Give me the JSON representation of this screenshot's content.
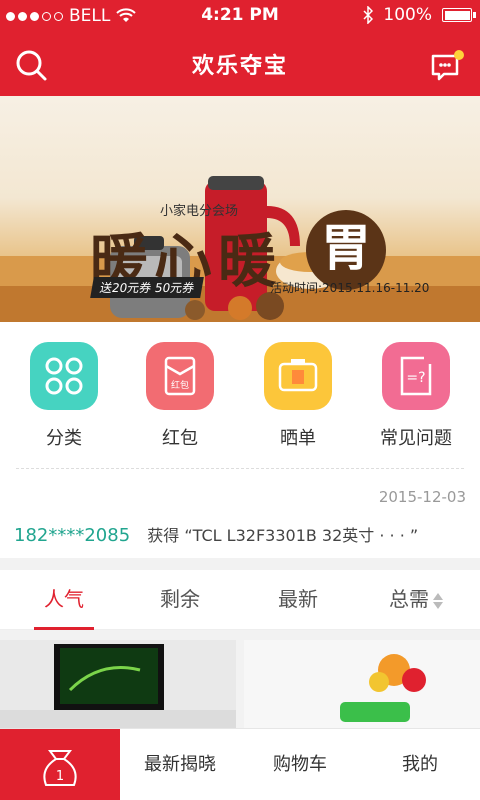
{
  "status_bar": {
    "carrier": "BELL",
    "time": "4:21 PM",
    "battery": "100%"
  },
  "nav": {
    "title": "欢乐夺宝"
  },
  "banner": {
    "subtitle": "小家电分会场",
    "headline": "暖心暖",
    "stamp": "胃",
    "coupon": "送20元券 50元券",
    "date": "活动时间:2015.11.16-11.20"
  },
  "quick_menu": [
    {
      "label": "分类",
      "icon": "category-grid-icon",
      "color": "#46d3c1"
    },
    {
      "label": "红包",
      "icon": "red-envelope-icon",
      "color": "#f26c72",
      "icon_text": "红包"
    },
    {
      "label": "晒单",
      "icon": "camera-icon",
      "color": "#fcc63a"
    },
    {
      "label": "常见问题",
      "icon": "faq-icon",
      "color": "#f26c93",
      "icon_text": "=?"
    }
  ],
  "winner": {
    "date": "2015-12-03",
    "user": "182****2085",
    "action": "获得",
    "prize": "“TCL L32F3301B 32英寸 · · · ”"
  },
  "tabs": [
    {
      "label": "人气",
      "active": true
    },
    {
      "label": "剩余",
      "active": false
    },
    {
      "label": "最新",
      "active": false
    },
    {
      "label": "总需",
      "active": false
    }
  ],
  "tabbar": {
    "home_badge": "1",
    "items": [
      "最新揭晓",
      "购物车",
      "我的"
    ]
  },
  "colors": {
    "brand": "#e0212f",
    "accent_green": "#21a58f"
  }
}
